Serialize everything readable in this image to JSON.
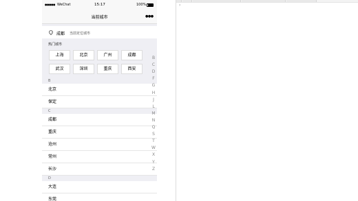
{
  "status_bar": {
    "signal": "●●●●●",
    "carrier": "WeChat",
    "time": "15:17",
    "battery_pct": "100%",
    "battery_level": 1.0
  },
  "nav": {
    "title": "当前城市",
    "menu_glyph": "●●●"
  },
  "current_city": {
    "name": "成都",
    "subtitle": "当前定位城市"
  },
  "hot": {
    "label": "热门城市",
    "cities": [
      "上海",
      "北京",
      "广州",
      "成都",
      "武汉",
      "深圳",
      "重庆",
      "西安"
    ]
  },
  "sections": [
    {
      "letter": "B",
      "cities": [
        "北京",
        "保定"
      ]
    },
    {
      "letter": "C",
      "cities": [
        "成都",
        "重庆",
        "沧州",
        "常州",
        "长沙"
      ]
    },
    {
      "letter": "D",
      "cities": [
        "大连",
        "东莞"
      ]
    }
  ],
  "index_letters": [
    "B",
    "C",
    "D",
    "F",
    "G",
    "H",
    "J",
    "L",
    "M",
    "N",
    "Q",
    "S",
    "T",
    "W",
    "X",
    "Y",
    "Z"
  ],
  "devtools": {
    "caret": "›"
  },
  "colors": {
    "page_bg": "#efeff4",
    "nav_bg": "#f8f8f8",
    "row_bg": "#ffffff",
    "index_text": "#888888"
  }
}
